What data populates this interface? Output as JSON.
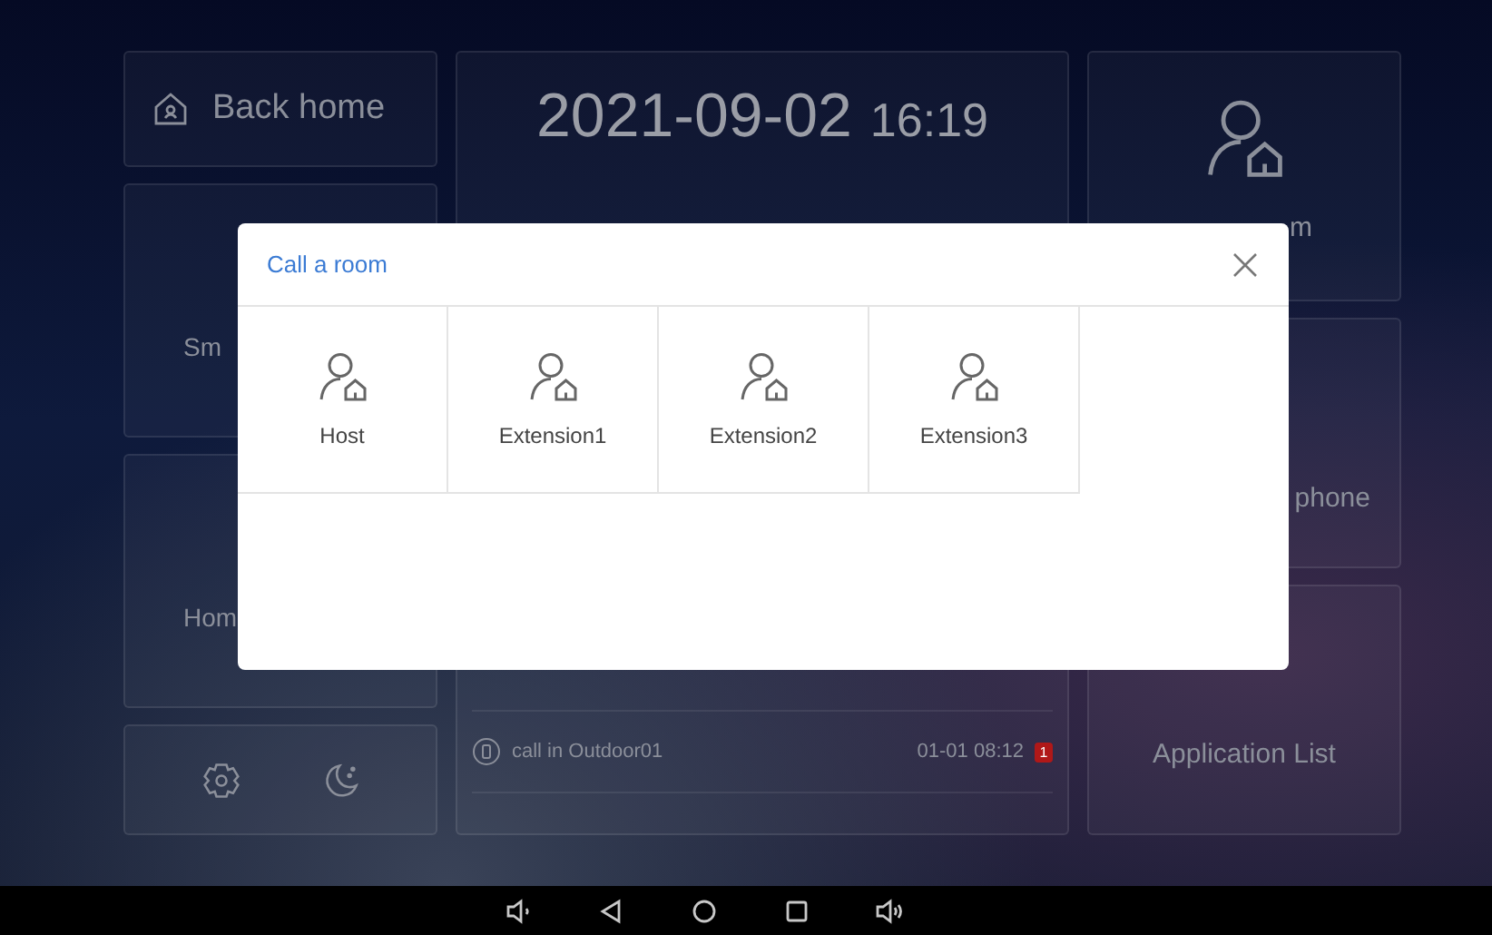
{
  "tiles_left": [
    {
      "kind": "home",
      "label": "Back home"
    },
    {
      "kind": "plain",
      "label": "Sm"
    },
    {
      "kind": "plain",
      "label": "Hom"
    },
    {
      "kind": "tools"
    }
  ],
  "clock": {
    "date": "2021-09-02",
    "time": "16:19"
  },
  "call_log": [
    {
      "text": "call in Outdoor01",
      "time": "01-01 08:12",
      "badge": "1"
    }
  ],
  "tiles_right": [
    {
      "kind": "room",
      "label": "m"
    },
    {
      "kind": "plain",
      "label": "phone"
    },
    {
      "kind": "apps",
      "label": "Application List"
    }
  ],
  "dialog": {
    "title": "Call a room",
    "rooms": [
      {
        "label": "Host"
      },
      {
        "label": "Extension1"
      },
      {
        "label": "Extension2"
      },
      {
        "label": "Extension3"
      }
    ]
  },
  "nav_bar": [
    {
      "kind": "volume-down"
    },
    {
      "kind": "back"
    },
    {
      "kind": "home"
    },
    {
      "kind": "recents"
    },
    {
      "kind": "volume-up"
    }
  ]
}
